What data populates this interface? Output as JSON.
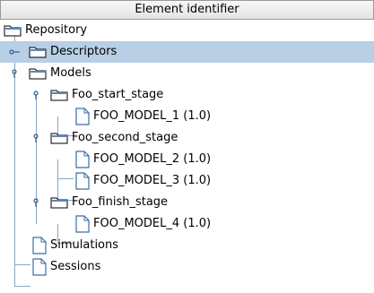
{
  "header": {
    "title": "Element identifier"
  },
  "tree": {
    "repository": "Repository",
    "descriptors": "Descriptors",
    "models": "Models",
    "foo_start_stage": "Foo_start_stage",
    "foo_model_1": "FOO_MODEL_1 (1.0)",
    "foo_second_stage": "Foo_second_stage",
    "foo_model_2": "FOO_MODEL_2 (1.0)",
    "foo_model_3": "FOO_MODEL_3 (1.0)",
    "foo_finish_stage": "Foo_finish_stage",
    "foo_model_4": "FOO_MODEL_4 (1.0)",
    "simulations": "Simulations",
    "sessions": "Sessions"
  },
  "colors": {
    "selection": "#b8cfe5",
    "connector": "#8aa6c2",
    "icon": "#5a88b8"
  }
}
